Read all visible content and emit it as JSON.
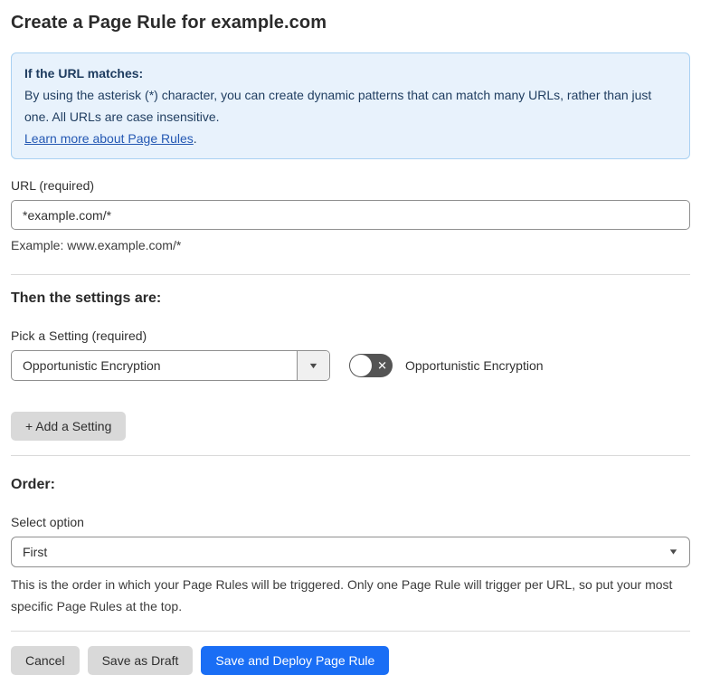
{
  "page": {
    "title": "Create a Page Rule for example.com"
  },
  "info_box": {
    "heading": "If the URL matches:",
    "body": "By using the asterisk (*) character, you can create dynamic patterns that can match many URLs, rather than just one. All URLs are case insensitive.",
    "link_label": "Learn more about Page Rules",
    "link_suffix": "."
  },
  "url_field": {
    "label": "URL (required)",
    "value": "*example.com/*",
    "helper": "Example: www.example.com/*"
  },
  "settings_section": {
    "heading": "Then the settings are:",
    "picker_label": "Pick a Setting (required)",
    "picker_value": "Opportunistic Encryption",
    "toggle_state": "off",
    "toggle_label": "Opportunistic Encryption",
    "add_setting_label": "+ Add a Setting"
  },
  "order_section": {
    "heading": "Order:",
    "select_label": "Select option",
    "select_value": "First",
    "helper": "This is the order in which your Page Rules will be triggered. Only one Page Rule will trigger per URL, so put your most specific Page Rules at the top."
  },
  "actions": {
    "cancel": "Cancel",
    "save_draft": "Save as Draft",
    "save_deploy": "Save and Deploy Page Rule"
  },
  "icons": {
    "dropdown_arrow": "▼",
    "toggle_x": "✕"
  },
  "colors": {
    "accent_blue": "#1a6ef5",
    "info_bg": "#e8f2fc",
    "info_border": "#a9d1f2",
    "info_text": "#1e3c5f",
    "link_blue": "#2458b3",
    "toggle_off_bg": "#545454",
    "button_gray": "#d9d9d9"
  }
}
